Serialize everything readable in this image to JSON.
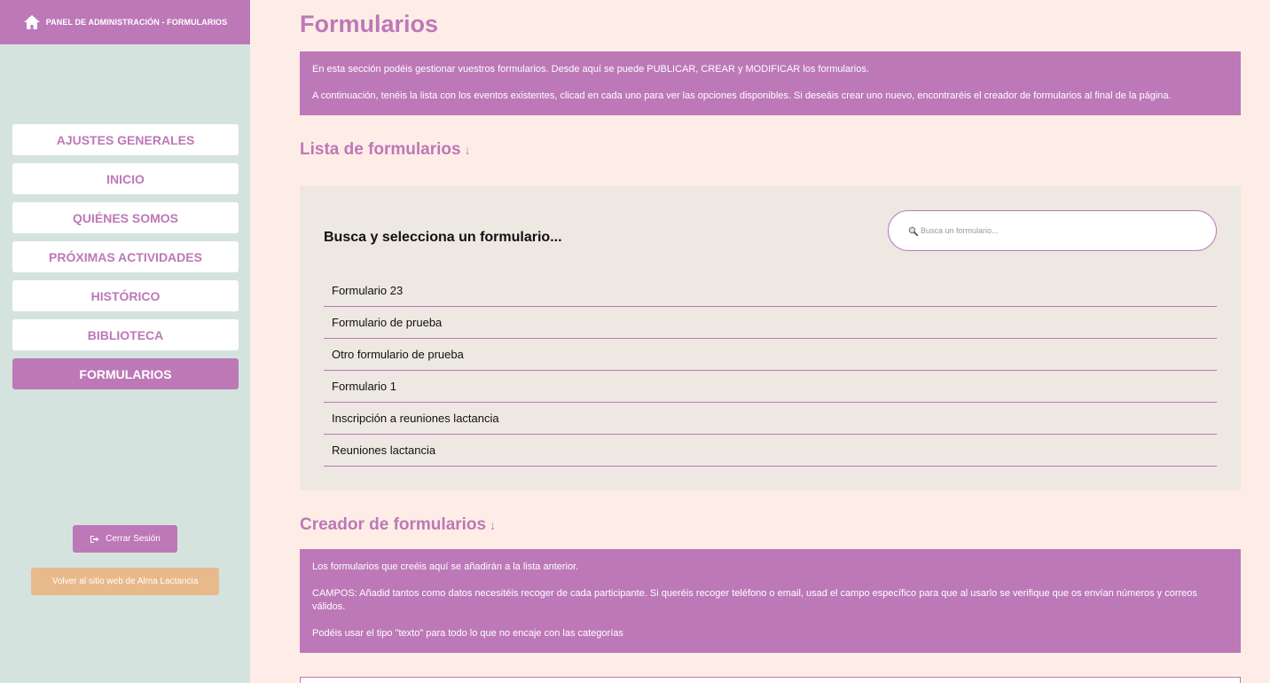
{
  "sidebar": {
    "header_title": "PANEL DE ADMINISTRACIÓN - FORMULARIOS",
    "header_icon": "home-icon",
    "items": [
      {
        "label": "AJUSTES GENERALES"
      },
      {
        "label": "INICIO"
      },
      {
        "label": "QUIÉNES SOMOS"
      },
      {
        "label": "PRÓXIMAS ACTIVIDADES"
      },
      {
        "label": "HISTÓRICO"
      },
      {
        "label": "BIBLIOTECA"
      },
      {
        "label": "FORMULARIOS",
        "active": true
      }
    ],
    "logout_label": "Cerrar Sesión",
    "logout_icon": "sign-out-icon",
    "back_label": "Volver al sitio web de Alma Lactancia"
  },
  "main": {
    "title": "Formularios",
    "intro": {
      "line1": "En esta sección podéis gestionar vuestros formularios. Desde aquí se puede PUBLICAR, CREAR y MODIFICAR los formularios.",
      "line2": "A continuación, tenéis la lista con los eventos existentes, clicad en cada uno para ver las opciones disponibles. Si deseáis crear uno nuevo, encontraréis el creador de formularios al final de la página."
    },
    "list_section": {
      "title": "Lista de formularios",
      "arrow": "↓",
      "search_label": "Busca y selecciona un formulario...",
      "search_placeholder": "Busca un formulario...",
      "items": [
        "Formulario 23",
        "Formulario de prueba",
        "Otro formulario de prueba",
        "Formulario 1",
        "Inscripción a reuniones lactancia",
        "Reuniones lactancia"
      ]
    },
    "creator_section": {
      "title": "Creador de formularios",
      "arrow": "↓",
      "line1": "Los formularios que creéis aquí se añadirán a la lista anterior.",
      "line2": "CAMPOS: Añadid tantos como datos necesitéis recoger de cada participante. Si queréis recoger teléfono o email, usad el campo específico para que al usarlo se verifique que os envían números y correos válidos.",
      "line3": "Podéis usar el tipo \"texto\" para todo lo que no encaje con las categorías"
    }
  },
  "colors": {
    "accent": "#bd78b8",
    "page_bg": "#feede6",
    "sidebar_bg": "#d5e3de",
    "panel_bg": "#ede8e2",
    "back_button": "#e8b98a"
  }
}
